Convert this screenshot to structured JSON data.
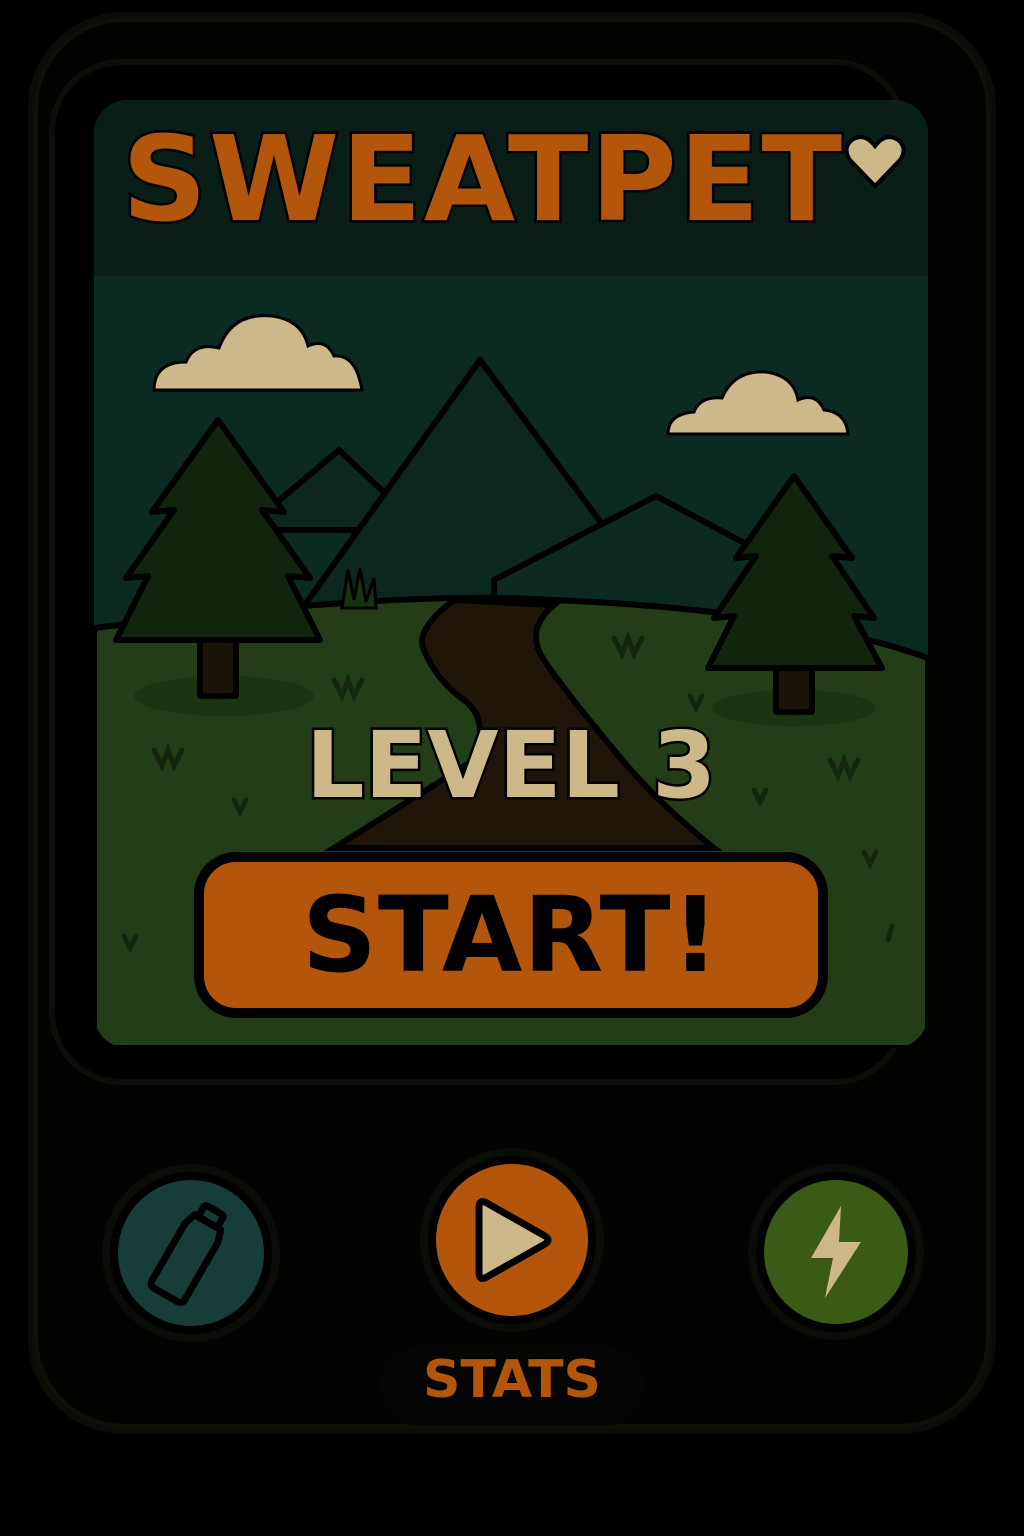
{
  "app": {
    "title": "SWEATPET"
  },
  "level": {
    "label": "LEVEL 3"
  },
  "start_button": {
    "label": "START!"
  },
  "bottom_bar": {
    "water_button_icon": "water-bottle-icon",
    "play_button_icon": "play-icon",
    "energy_button_icon": "lightning-bolt-icon",
    "stats_label": "STATS"
  },
  "colors": {
    "accent_orange": "#b3560c",
    "cream": "#cdb88a",
    "header_bg": "#0a1e18",
    "sky": "#0b2a22",
    "grass": "#233e16",
    "water_button": "#163d38",
    "energy_button": "#3a5a15"
  }
}
